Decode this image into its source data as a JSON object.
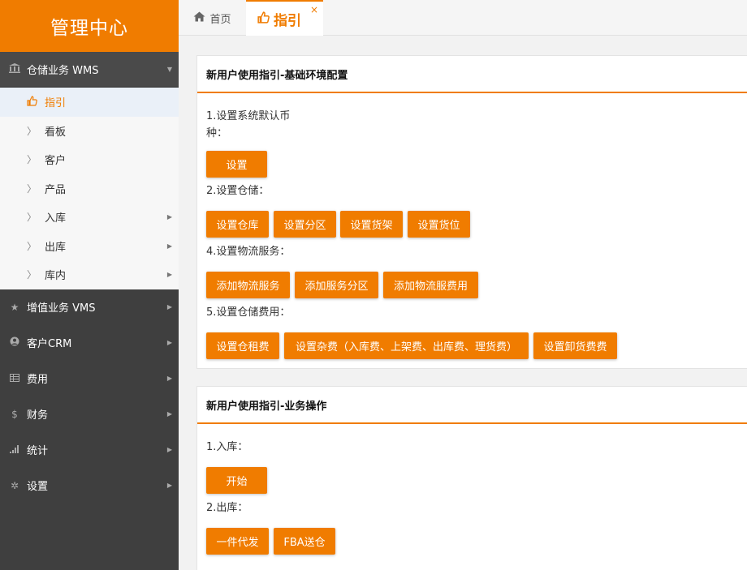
{
  "sidebar": {
    "brand": "管理中心",
    "wms": {
      "label": "仓储业务 WMS",
      "icon": "bank-icon"
    },
    "sub_items": [
      {
        "label": "指引",
        "icon": "thumbs-up-icon",
        "active": true
      },
      {
        "label": "看板",
        "icon": "chevron-right-icon"
      },
      {
        "label": "客户",
        "icon": "chevron-right-icon"
      },
      {
        "label": "产品",
        "icon": "chevron-right-icon"
      },
      {
        "label": "入库",
        "icon": "chevron-right-icon"
      },
      {
        "label": "出库",
        "icon": "chevron-right-icon"
      },
      {
        "label": "库内",
        "icon": "chevron-right-icon"
      }
    ],
    "groups": [
      {
        "label": "增值业务 VMS",
        "icon": "star-icon"
      },
      {
        "label": "客户CRM",
        "icon": "user-circle-icon"
      },
      {
        "label": "费用",
        "icon": "table-icon"
      },
      {
        "label": "财务",
        "icon": "dollar-icon"
      },
      {
        "label": "统计",
        "icon": "bar-chart-icon"
      },
      {
        "label": "设置",
        "icon": "gear-icon"
      }
    ]
  },
  "tabs": {
    "home": "首页",
    "guide": "指引",
    "close": "×"
  },
  "panel1": {
    "title": "新用户使用指引-基础环境配置",
    "step1": "1.设置系统默认币",
    "step1b": "种：",
    "btn_set": "设置",
    "step2": "2.设置仓储：",
    "btn_warehouse": "设置仓库",
    "btn_zone": "设置分区",
    "btn_shelf": "设置货架",
    "btn_location": "设置货位",
    "step4": "4.设置物流服务：",
    "btn_add_service": "添加物流服务",
    "btn_add_zone": "添加服务分区",
    "btn_add_fee": "添加物流服费用",
    "step5": "5.设置仓储费用：",
    "btn_rent": "设置仓租费",
    "btn_misc": "设置杂费（入库费、上架费、出库费、理货费）",
    "btn_unload": "设置卸货费费"
  },
  "panel2": {
    "title": "新用户使用指引-业务操作",
    "step1": "1.入库：",
    "btn_start": "开始",
    "step2": "2.出库：",
    "btn_dropship": "一件代发",
    "btn_fba": "FBA送仓"
  },
  "colors": {
    "accent": "#f07c00",
    "sidebar_bg": "#3f3f3f"
  }
}
